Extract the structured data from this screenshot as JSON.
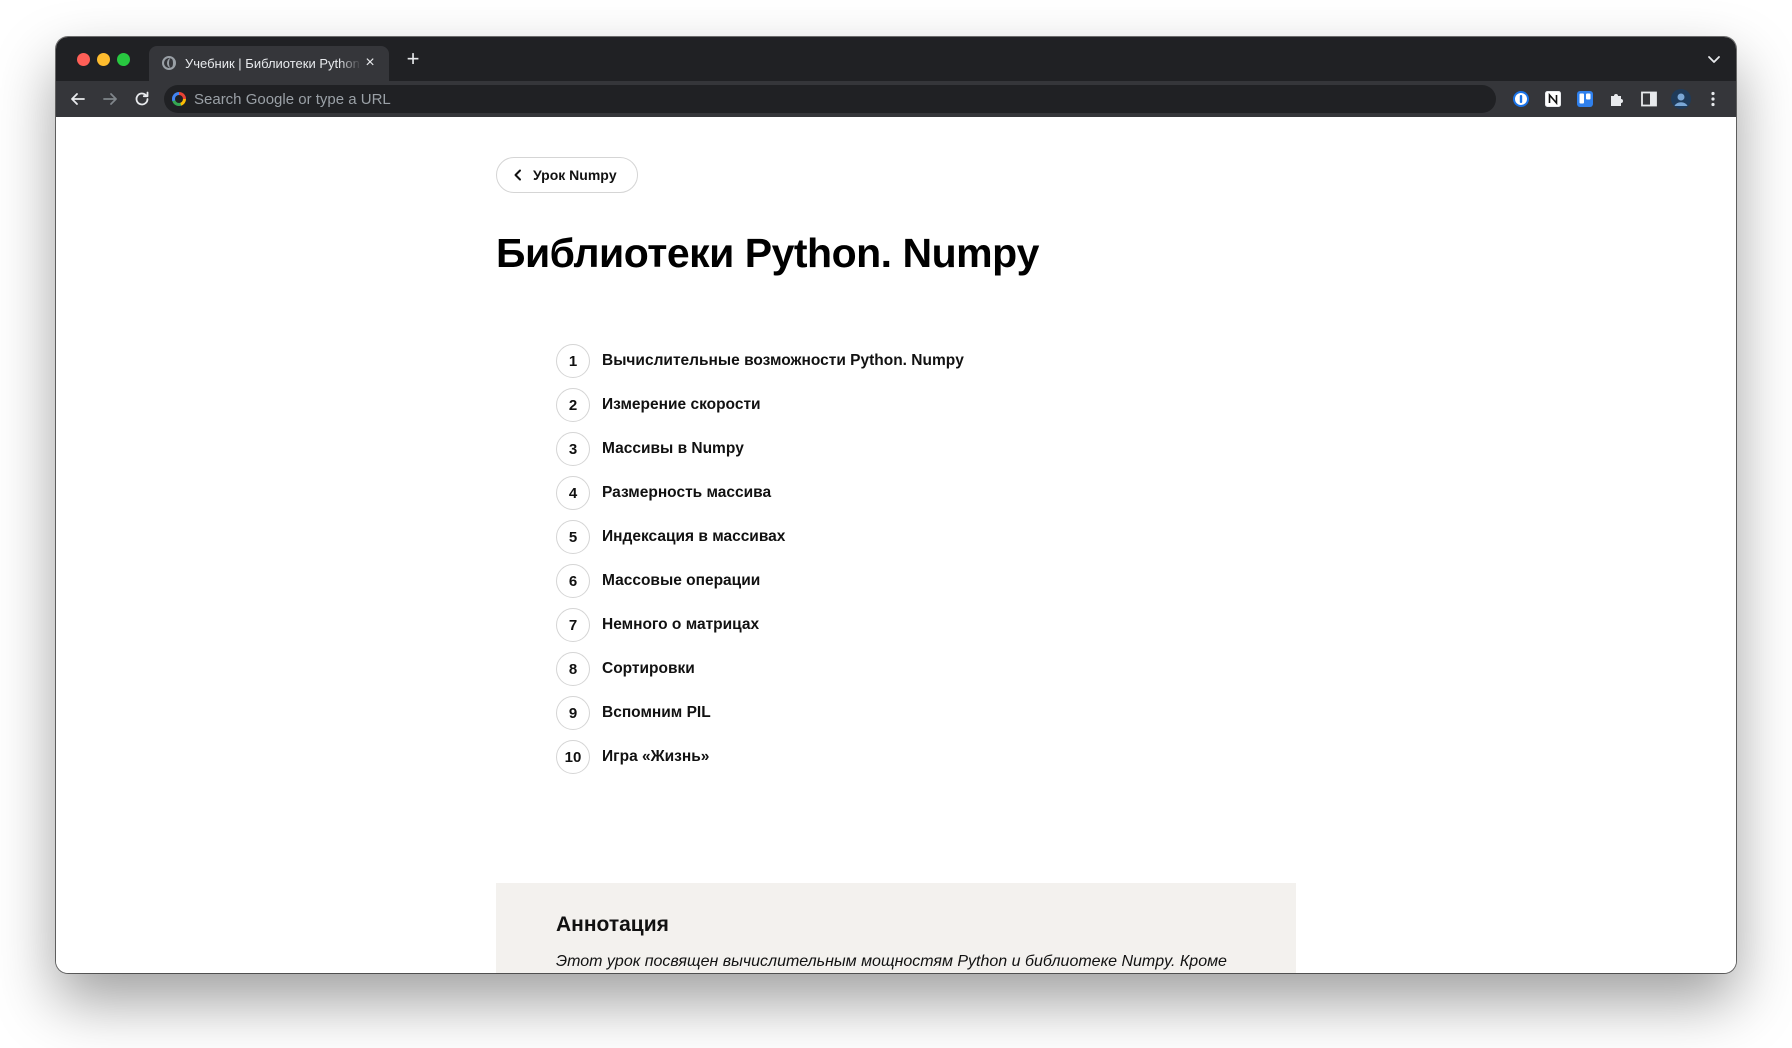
{
  "browser": {
    "tab": {
      "title": "Учебник | Библиотеки Python. Numpy",
      "close_glyph": "×"
    },
    "new_tab_glyph": "+",
    "omnibox": {
      "placeholder": "Search Google or type a URL",
      "value": ""
    },
    "icons": {
      "back": "arrow-left-icon",
      "forward": "arrow-right-icon",
      "reload": "reload-icon",
      "extensions": [
        "1password-icon",
        "notion-icon",
        "trello-icon",
        "puzzle-icon",
        "side-panel-icon",
        "profile-avatar",
        "kebab-menu-icon"
      ]
    },
    "colors": {
      "frame": "#202124",
      "toolbar": "#35363a",
      "traffic_red": "#ff5f57",
      "traffic_yellow": "#febc2e",
      "traffic_green": "#28c840"
    }
  },
  "page": {
    "back_button_label": "Урок Numpy",
    "title": "Библиотеки Python. Numpy",
    "lessons": [
      {
        "num": "1",
        "title": "Вычислительные возможности Python. Numpy"
      },
      {
        "num": "2",
        "title": "Измерение скорости"
      },
      {
        "num": "3",
        "title": "Массивы в Numpy"
      },
      {
        "num": "4",
        "title": "Размерность массива"
      },
      {
        "num": "5",
        "title": "Индексация в массивах"
      },
      {
        "num": "6",
        "title": "Массовые операции"
      },
      {
        "num": "7",
        "title": "Немного о матрицах"
      },
      {
        "num": "8",
        "title": "Сортировки"
      },
      {
        "num": "9",
        "title": "Вспомним PIL"
      },
      {
        "num": "10",
        "title": "Игра «Жизнь»"
      }
    ],
    "annotation": {
      "title": "Аннотация",
      "text": "Этот урок посвящен вычислительным мощностям Python и библиотеке Numpy. Кроме"
    }
  }
}
